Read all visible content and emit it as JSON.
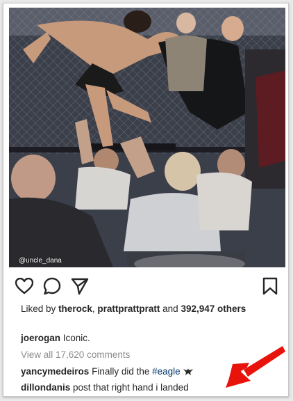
{
  "post": {
    "photo_credit": "@uncle_dana",
    "likes": {
      "prefix": "Liked by",
      "user1": "therock",
      "separator": ",",
      "user2": "prattprattpratt",
      "and": "and",
      "count": "392,947",
      "suffix": "others"
    },
    "comments": [
      {
        "user": "joerogan",
        "text": "Iconic."
      },
      {
        "user": "yancymedeiros",
        "text": "Finally did the",
        "hashtag": "#eagle",
        "emoji": "eagle-emoji"
      },
      {
        "user": "dillondanis",
        "text": "post that right hand i landed"
      }
    ],
    "view_all": "View all 17,620 comments"
  },
  "actions": {
    "like": "heart-icon",
    "comment": "comment-bubble-icon",
    "share": "paper-plane-icon",
    "save": "bookmark-icon"
  },
  "colors": {
    "text": "#262626",
    "muted": "#8e8e8e",
    "hashtag": "#003569",
    "annotation_arrow": "#e8140c"
  }
}
